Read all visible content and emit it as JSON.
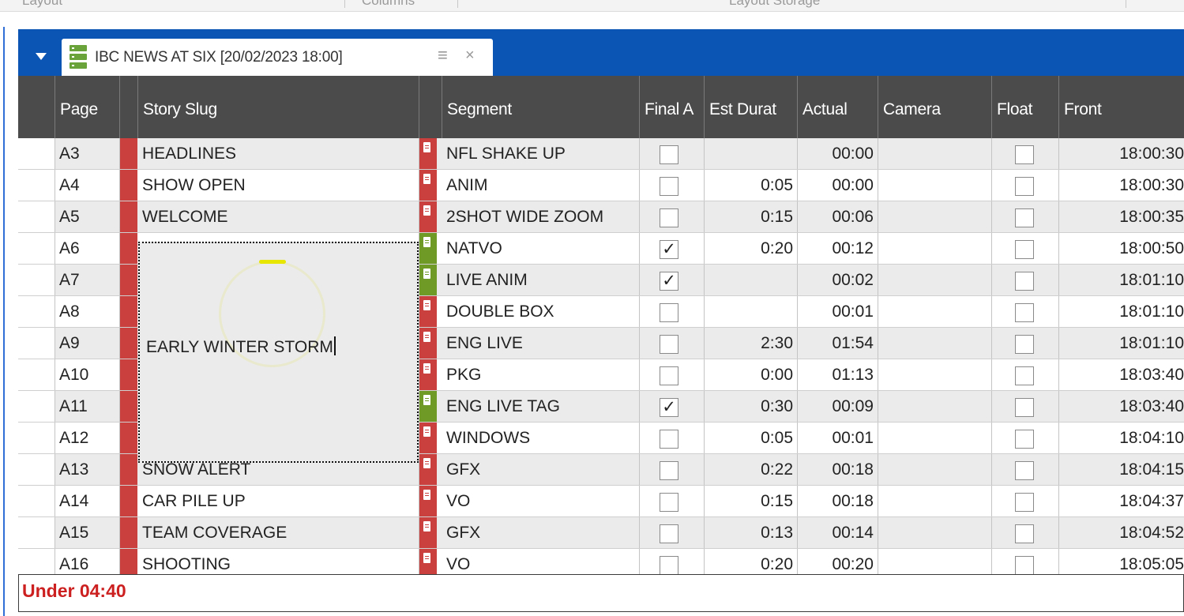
{
  "ribbon": {
    "labels": [
      "Layout",
      "Columns",
      "Layout Storage"
    ]
  },
  "tab": {
    "title": "IBC NEWS AT SIX [20/02/2023 18:00]",
    "menu_icon": "≡",
    "close_icon": "×"
  },
  "columns": [
    "",
    "Page",
    "",
    "Story Slug",
    "",
    "Segment",
    "Final A",
    "Est Durat",
    "Actual",
    "Camera",
    "Float",
    "Front"
  ],
  "rows": [
    {
      "page": "A3",
      "slug": "HEADLINES",
      "segment": "NFL SHAKE UP",
      "final": false,
      "est": "",
      "actual": "00:00",
      "float": false,
      "front": "18:00:30",
      "seg_color": "red"
    },
    {
      "page": "A4",
      "slug": "SHOW OPEN",
      "segment": "ANIM",
      "final": false,
      "est": "0:05",
      "actual": "00:00",
      "float": false,
      "front": "18:00:30",
      "seg_color": "red"
    },
    {
      "page": "A5",
      "slug": "WELCOME",
      "segment": "2SHOT WIDE ZOOM",
      "final": false,
      "est": "0:15",
      "actual": "00:06",
      "float": false,
      "front": "18:00:35",
      "seg_color": "red"
    },
    {
      "page": "A6",
      "slug": "",
      "segment": "NATVO",
      "final": true,
      "est": "0:20",
      "actual": "00:12",
      "float": false,
      "front": "18:00:50",
      "seg_color": "green"
    },
    {
      "page": "A7",
      "slug": "",
      "segment": "LIVE ANIM",
      "final": true,
      "est": "",
      "actual": "00:02",
      "float": false,
      "front": "18:01:10",
      "seg_color": "green"
    },
    {
      "page": "A8",
      "slug": "",
      "segment": "DOUBLE BOX",
      "final": false,
      "est": "",
      "actual": "00:01",
      "float": false,
      "front": "18:01:10",
      "seg_color": "red"
    },
    {
      "page": "A9",
      "slug": "",
      "segment": "ENG LIVE",
      "final": false,
      "est": "2:30",
      "actual": "01:54",
      "float": false,
      "front": "18:01:10",
      "seg_color": "red"
    },
    {
      "page": "A10",
      "slug": "",
      "segment": "PKG",
      "final": false,
      "est": "0:00",
      "actual": "01:13",
      "float": false,
      "front": "18:03:40",
      "seg_color": "red"
    },
    {
      "page": "A11",
      "slug": "",
      "segment": "ENG LIVE TAG",
      "final": true,
      "est": "0:30",
      "actual": "00:09",
      "float": false,
      "front": "18:03:40",
      "seg_color": "green"
    },
    {
      "page": "A12",
      "slug": "",
      "segment": "WINDOWS",
      "final": false,
      "est": "0:05",
      "actual": "00:01",
      "float": false,
      "front": "18:04:10",
      "seg_color": "red"
    },
    {
      "page": "A13",
      "slug": "SNOW ALERT",
      "segment": "GFX",
      "final": false,
      "est": "0:22",
      "actual": "00:18",
      "float": false,
      "front": "18:04:15",
      "seg_color": "red"
    },
    {
      "page": "A14",
      "slug": "CAR PILE UP",
      "segment": "VO",
      "final": false,
      "est": "0:15",
      "actual": "00:18",
      "float": false,
      "front": "18:04:37",
      "seg_color": "red"
    },
    {
      "page": "A15",
      "slug": "TEAM COVERAGE",
      "segment": "GFX",
      "final": false,
      "est": "0:13",
      "actual": "00:14",
      "float": false,
      "front": "18:04:52",
      "seg_color": "red"
    },
    {
      "page": "A16",
      "slug": "SHOOTING",
      "segment": "VO",
      "final": false,
      "est": "0:20",
      "actual": "00:20",
      "float": false,
      "front": "18:05:05",
      "seg_color": "red"
    }
  ],
  "editing_slug": "EARLY WINTER STORM",
  "status": {
    "text": "Under 04:40"
  },
  "colors": {
    "panel_blue": "#0b56b4",
    "header_gray": "#4b4b4b",
    "marker_red": "#c9403f",
    "marker_green": "#6f9a25",
    "status_red": "#cc1f1f"
  }
}
